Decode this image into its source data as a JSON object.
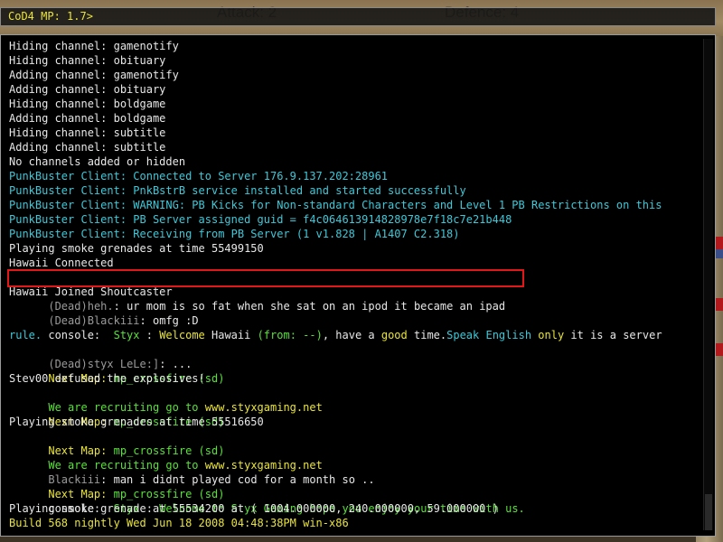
{
  "hud": {
    "attack": "Attack: 2",
    "defence": "Defence: 4"
  },
  "console_input": {
    "prompt": "CoD4 MP: 1.7>"
  },
  "colors": {
    "white": "#e8e8e8",
    "cyan": "#3ec8d8",
    "green": "#5ae03a",
    "yellow": "#e9e43a",
    "grey": "#9a9a9a",
    "highlight": "#e01818"
  },
  "lines": {
    "l1": "Hiding channel: gamenotify",
    "l2": "Hiding channel: obituary",
    "l3": "Adding channel: gamenotify",
    "l4": "Adding channel: obituary",
    "l5": "Hiding channel: boldgame",
    "l6": "Adding channel: boldgame",
    "l7": "Hiding channel: subtitle",
    "l8": "Adding channel: subtitle",
    "l9": "No channels added or hidden",
    "l10": "PunkBuster Client: Connected to Server 176.9.137.202:28961",
    "l11": "PunkBuster Client: PnkBstrB service installed and started successfully",
    "l12": "PunkBuster Client: WARNING: PB Kicks for Non-standard Characters and Level 1 PB Restrictions on this",
    "l13": "PunkBuster Client: PB Server assigned guid = f4c064613914828978e7f18c7e21b448",
    "l14": "PunkBuster Client: Receiving from PB Server (1 v1.828 | A1407 C2.318)",
    "l15": "Playing smoke grenades at time 55499150",
    "l16": "Hawaii Connected",
    "l17_dead": "(Dead)",
    "l17_name": "heh.",
    "l17_msg": ": ur mom is so fat when she sat on an ipod it became an ipad",
    "l18": "Hawaii Joined Shoutcaster",
    "l19_dead": "(Dead)",
    "l19_name": "Blackiii",
    "l19_msg": ": omfg :D",
    "l20_pre": "console:  ",
    "l20_styx": "Styx",
    "l20_colon": " : ",
    "l20_welcome": "Welcome ",
    "l20_hawaii": "Hawaii ",
    "l20_from": "(from: --)",
    "l20_have": ", have a ",
    "l20_good": "good",
    "l20_time": " time.",
    "l20_speak": "Speak English ",
    "l20_only": "only",
    "l20_rest": " it is a server",
    "l21": "rule.",
    "l22_dead": "(Dead)",
    "l22_name": "styx LeLe:]",
    "l22_msg": ": ...",
    "l23_label": "Next Map: ",
    "l23_map": "mp_crossfire (sd)",
    "l24": "Stev00 defused the explosives!",
    "l25_a": "We are recruiting go to ",
    "l25_b": "www.styxgaming.net",
    "l26_label": "Next Map: ",
    "l26_map": "mp_crossfire (sd)",
    "l27": "Playing smoke grenades at time 55516650",
    "l28_label": "Next Map: ",
    "l28_map": "mp_crossfire (sd)",
    "l29_a": "We are recruiting go to ",
    "l29_b": "www.styxgaming.net",
    "l30_name": "Blackiii",
    "l30_msg": ": man i didnt played cod for a month so ..",
    "l31_label": "Next Map: ",
    "l31_map": "mp_crossfire (sd)",
    "l32_pre": "console:  ",
    "l32_styx": "Styx",
    "l32_colon": " : ",
    "l32_msg": "Welcome to Styx Gaming hope you enjoy your time with us.",
    "l33": "Playing smoke grenade at 55534200 at ( 1004.000000, 240.000000, 59.000000 )",
    "l34": "Build 568 nightly Wed Jun 18 2008 04:48:38PM win-x86"
  }
}
